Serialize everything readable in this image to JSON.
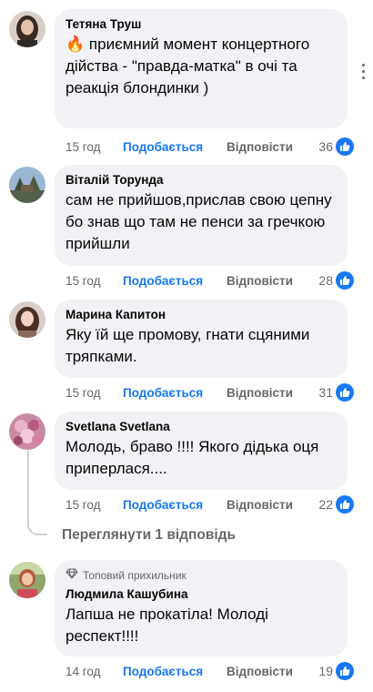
{
  "comments": [
    {
      "author": "Тетяна Труш",
      "emoji": "🔥",
      "text": "приємний момент концертного дійства - \"правда-матка\" в очі та реакція блондинки )",
      "time": "15 год",
      "like_label": "Подобається",
      "reply_label": "Відповісти",
      "likes": "36"
    },
    {
      "author": "Віталій Торунда",
      "text": "сам не прийшов,прислав свою цепну бо знав що там не пенси за гречкою прийшли",
      "time": "15 год",
      "like_label": "Подобається",
      "reply_label": "Відповісти",
      "likes": "28"
    },
    {
      "author": "Марина Капитон",
      "text": "Яку їй ще промову, гнати сцяними тряпками.",
      "time": "15 год",
      "like_label": "Подобається",
      "reply_label": "Відповісти",
      "likes": "31"
    },
    {
      "author": "Svetlana Svetlana",
      "text": "Молодь, браво !!!! Якого дідька оця приперлася....",
      "time": "15 год",
      "like_label": "Подобається",
      "reply_label": "Відповісти",
      "likes": "22"
    },
    {
      "badge": "Топовий прихильник",
      "author": "Людмила Кашубина",
      "text": "Лапша не прокатіла! Молоді респект!!!!",
      "time": "14 год",
      "like_label": "Подобається",
      "reply_label": "Відповісти",
      "likes": "19"
    }
  ],
  "view_replies": "Переглянути 1 відповідь",
  "colors": {
    "accent": "#1877f2",
    "bubble": "#f0f2f5",
    "muted": "#65676b"
  }
}
